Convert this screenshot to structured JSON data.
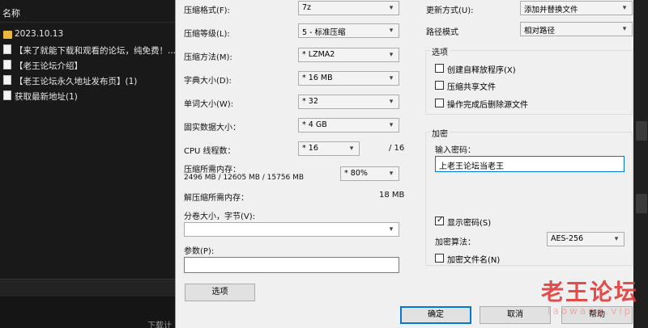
{
  "explorer": {
    "header": "名称",
    "rows": [
      {
        "type": "folder",
        "label": "2023.10.13"
      },
      {
        "type": "file",
        "label": "【来了就能下载和观看的论坛，纯免费！..."
      },
      {
        "type": "file",
        "label": "【老王论坛介绍】"
      },
      {
        "type": "file",
        "label": "【老王论坛永久地址发布页】(1)"
      },
      {
        "type": "file",
        "label": "获取最新地址(1)"
      }
    ],
    "download_text": "下载计"
  },
  "dialog": {
    "format_label": "压缩格式(F):",
    "format_value": "7z",
    "level_label": "压缩等级(L):",
    "level_value": "5 - 标准压缩",
    "method_label": "压缩方法(M):",
    "method_value": "* LZMA2",
    "dict_label": "字典大小(D):",
    "dict_value": "* 16 MB",
    "word_label": "单词大小(W):",
    "word_value": "* 32",
    "solid_label": "固实数据大小：",
    "solid_value": "* 4 GB",
    "cpu_label": "CPU 线程数：",
    "cpu_value": "* 16",
    "cpu_total": "/ 16",
    "mem_label": "压缩所需内存：",
    "mem_detail": "2496 MB / 12605 MB / 15756 MB",
    "mem_value": "* 80%",
    "demem_label": "解压缩所需内存：",
    "demem_value": "18 MB",
    "split_label": "分卷大小，字节(V):",
    "split_value": "",
    "params_label": "参数(P):",
    "params_value": "",
    "options_button": "选项",
    "update_label": "更新方式(U):",
    "update_value": "添加并替换文件",
    "path_label": "路径模式",
    "path_value": "相对路径",
    "options_group": {
      "title": "选项",
      "sfx": "创建自释放程序(X)",
      "shared": "压缩共享文件",
      "delete": "操作完成后删除源文件"
    },
    "encrypt_group": {
      "title": "加密",
      "password_label": "输入密码：",
      "password_value": "上老王论坛当老王",
      "show_password": "显示密码(S)",
      "show_password_checked": true,
      "algo_label": "加密算法：",
      "algo_value": "AES-256",
      "encrypt_names": "加密文件名(N)"
    },
    "ok_button": "确定",
    "cancel_button": "取消",
    "help_button": "帮助"
  },
  "watermark": {
    "title": "老王论坛",
    "sub": "laowang.vip"
  }
}
